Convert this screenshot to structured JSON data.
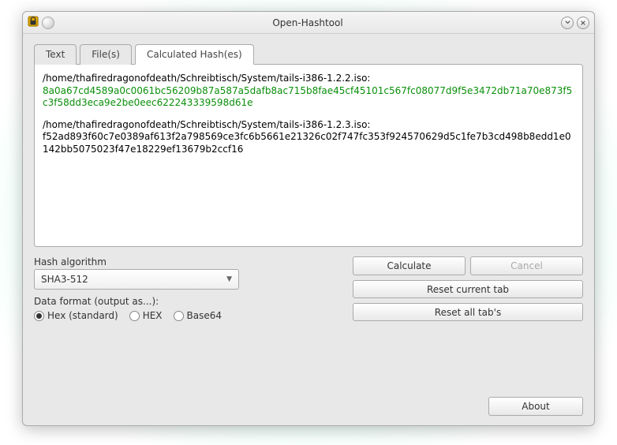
{
  "window": {
    "title": "Open-Hashtool"
  },
  "tabs": {
    "items": [
      {
        "label": "Text"
      },
      {
        "label": "File(s)"
      },
      {
        "label": "Calculated Hash(es)"
      }
    ],
    "active": 2
  },
  "results": [
    {
      "path": "/home/thafiredragonofdeath/Schreibtisch/System/tails-i386-1.2.2.iso:",
      "hash": "8a0a67cd4589a0c0061bc56209b87a587a5dafb8ac715b8fae45cf45101c567fc08077d9f5e3472db71a70e873f5c3f58dd3eca9e2be0eec622243339598d61e",
      "highlight": true
    },
    {
      "path": "/home/thafiredragonofdeath/Schreibtisch/System/tails-i386-1.2.3.iso:",
      "hash": "f52ad893f60c7e0389af613f2a798569ce3fc6b5661e21326c02f747fc353f924570629d5c1fe7b3cd498b8edd1e0142bb5075023f47e18229ef13679b2ccf16",
      "highlight": false
    }
  ],
  "algorithm": {
    "label": "Hash algorithm",
    "value": "SHA3-512"
  },
  "format": {
    "label": "Data format (output as...):",
    "options": [
      {
        "label": "Hex (standard)",
        "checked": true
      },
      {
        "label": "HEX",
        "checked": false
      },
      {
        "label": "Base64",
        "checked": false
      }
    ]
  },
  "buttons": {
    "calculate": "Calculate",
    "cancel": "Cancel",
    "reset_current": "Reset current tab",
    "reset_all": "Reset all tab's",
    "about": "About"
  }
}
